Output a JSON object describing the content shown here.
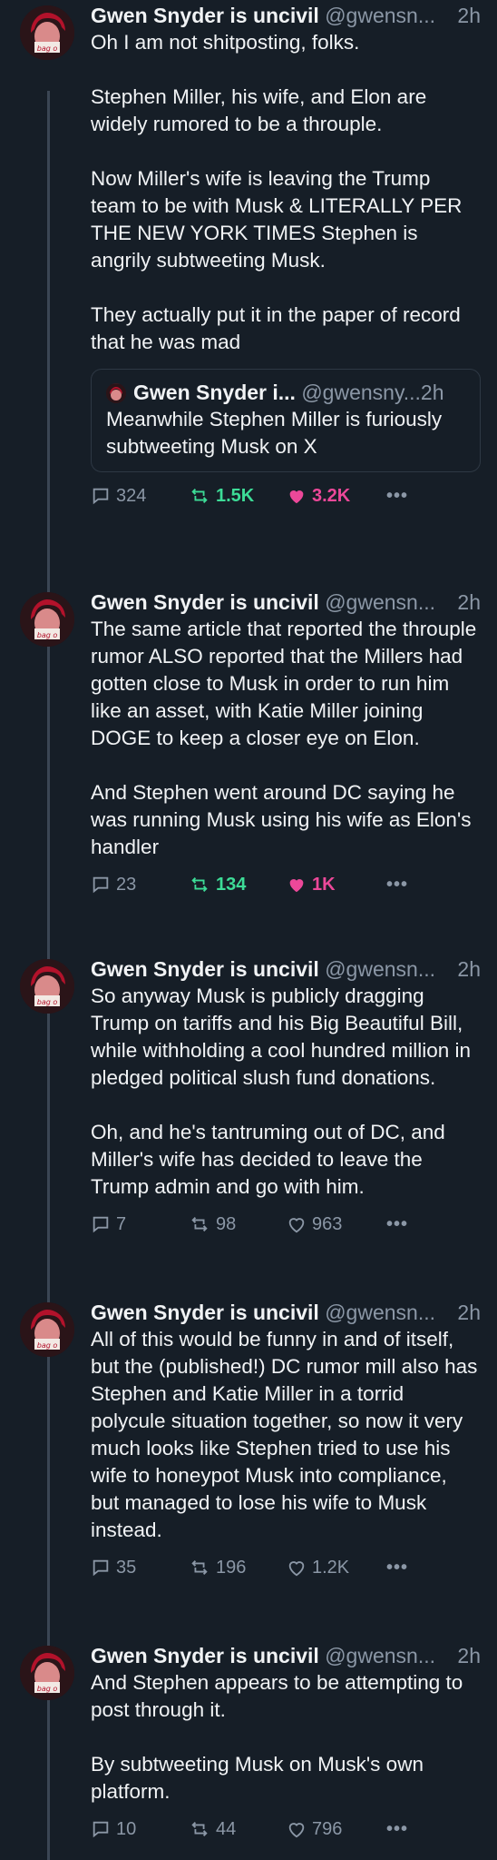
{
  "posts": [
    {
      "author": "Gwen Snyder is uncivil",
      "handle": "@gwensn...",
      "time": "2h",
      "paragraphs": [
        "Oh I am not shitposting, folks.",
        "Stephen Miller, his wife, and Elon are widely rumored to be a throuple.",
        "Now Miller's wife is leaving the Trump team to be with Musk & LITERALLY PER THE NEW YORK TIMES Stephen is angrily subtweeting Musk.",
        "They actually put it in the paper of record that he was mad"
      ],
      "quote": {
        "author": "Gwen Snyder i...",
        "handle": "@gwensny...",
        "time": "2h",
        "text": "Meanwhile Stephen Miller is furiously subtweeting Musk on X"
      },
      "replies": "324",
      "reposts": "1.5K",
      "likes": "3.2K",
      "reposted": true,
      "liked": true
    },
    {
      "author": "Gwen Snyder is uncivil",
      "handle": "@gwensn...",
      "time": "2h",
      "paragraphs": [
        "The same article that reported the throuple rumor ALSO reported that the Millers had gotten close to Musk in order to run him like an asset, with Katie Miller joining DOGE to keep a closer eye on Elon.",
        "And Stephen went around DC saying he was running Musk using his wife as Elon's handler"
      ],
      "replies": "23",
      "reposts": "134",
      "likes": "1K",
      "reposted": true,
      "liked": true
    },
    {
      "author": "Gwen Snyder is uncivil",
      "handle": "@gwensn...",
      "time": "2h",
      "paragraphs": [
        "So anyway Musk is publicly dragging Trump on tariffs and his Big Beautiful Bill, while withholding a cool hundred million in pledged political slush fund donations.",
        "Oh, and he's tantruming out of DC, and Miller's wife has decided to leave the Trump admin and go with him."
      ],
      "replies": "7",
      "reposts": "98",
      "likes": "963",
      "reposted": false,
      "liked": false
    },
    {
      "author": "Gwen Snyder is uncivil",
      "handle": "@gwensn...",
      "time": "2h",
      "paragraphs": [
        "All of this would be funny in and of itself, but the (published!) DC rumor mill also has Stephen and Katie Miller in a torrid polycule situation together, so now it very much looks like Stephen tried to use his wife to honeypot Musk into compliance, but managed to lose his wife to Musk instead."
      ],
      "replies": "35",
      "reposts": "196",
      "likes": "1.2K",
      "reposted": false,
      "liked": false
    },
    {
      "author": "Gwen Snyder is uncivil",
      "handle": "@gwensn...",
      "time": "2h",
      "paragraphs": [
        "And Stephen appears to be attempting to post through it.",
        "By subtweeting Musk on Musk's own platform."
      ],
      "replies": "10",
      "reposts": "44",
      "likes": "796",
      "reposted": false,
      "liked": false
    }
  ],
  "more_label": "•••",
  "avatar_text": "bag o",
  "colors": {
    "background": "#161e27",
    "repost_active": "#3ddc97",
    "like_active": "#ec4899",
    "muted": "#8b97a6"
  }
}
